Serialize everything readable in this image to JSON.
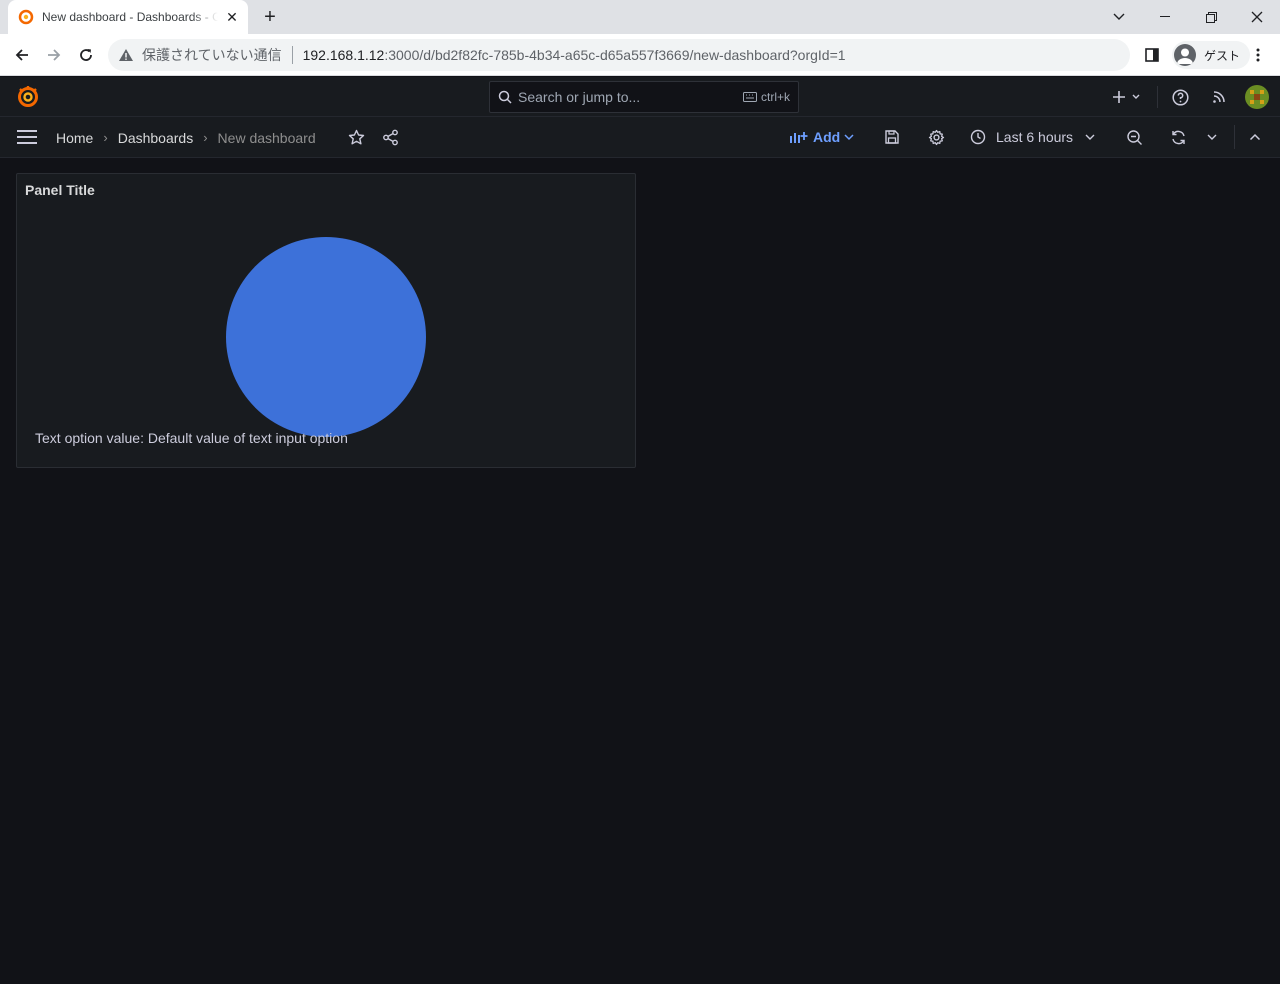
{
  "browser": {
    "tab_title": "New dashboard - Dashboards - Grafana",
    "insecure_label": "保護されていない通信",
    "url_host": "192.168.1.12",
    "url_rest": ":3000/d/bd2f82fc-785b-4b34-a65c-d65a557f3669/new-dashboard?orgId=1",
    "profile_label": "ゲスト"
  },
  "topnav": {
    "search_placeholder": "Search or jump to...",
    "search_shortcut": "ctrl+k"
  },
  "toolbar": {
    "breadcrumbs": [
      "Home",
      "Dashboards",
      "New dashboard"
    ],
    "add_label": "Add",
    "time_range": "Last 6 hours"
  },
  "panel": {
    "title": "Panel Title",
    "text": "Text option value: Default value of text input option",
    "circle_color": "#3d71d9"
  },
  "colors": {
    "accent": "#6e9fff",
    "background": "#111217",
    "surface": "#181b1f"
  }
}
